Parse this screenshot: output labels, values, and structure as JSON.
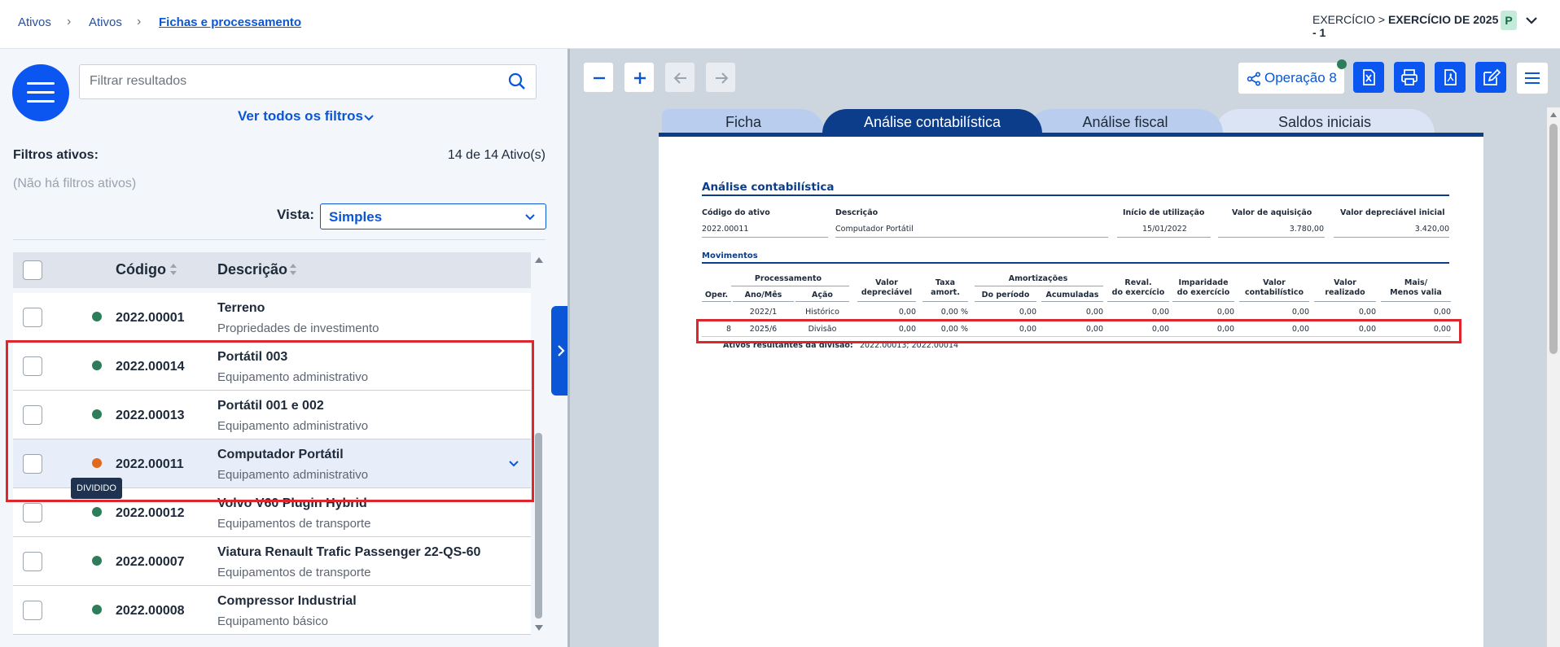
{
  "breadcrumb": {
    "items": [
      "Ativos",
      "Ativos"
    ],
    "current": "Fichas e processamento"
  },
  "exercise": {
    "prefix": "EXERCÍCIO > ",
    "value": "EXERCÍCIO DE 2025 - 1",
    "badge": "P"
  },
  "left": {
    "search_placeholder": "Filtrar resultados",
    "all_filters_label": "Ver todos os filtros",
    "active_filters_label": "Filtros ativos:",
    "count": "14 de 14 Ativo(s)",
    "no_filters": "(Não há filtros ativos)",
    "vista_label": "Vista:",
    "vista_value": "Simples",
    "columns": {
      "code": "Código",
      "description": "Descrição"
    },
    "rows": [
      {
        "code": "2022.00001",
        "name": "Terreno",
        "category": "Propriedades de investimento",
        "status": "active"
      },
      {
        "code": "2022.00014",
        "name": "Portátil 003",
        "category": "Equipamento administrativo",
        "status": "active"
      },
      {
        "code": "2022.00013",
        "name": "Portátil 001 e 002",
        "category": "Equipamento administrativo",
        "status": "active"
      },
      {
        "code": "2022.00011",
        "name": "Computador Portátil",
        "category": "Equipamento administrativo",
        "status": "divided"
      },
      {
        "code": "2022.00012",
        "name": "Volvo V60 Plugin Hybrid",
        "category": "Equipamentos de transporte",
        "status": "active"
      },
      {
        "code": "2022.00007",
        "name": "Viatura Renault Trafic Passenger 22-QS-60",
        "category": "Equipamentos de transporte",
        "status": "active"
      },
      {
        "code": "2022.00008",
        "name": "Compressor Industrial",
        "category": "Equipamento básico",
        "status": "active"
      }
    ],
    "tooltip": "DIVIDIDO"
  },
  "toolbar": {
    "operation_label": "Operação 8"
  },
  "tabs": [
    "Ficha",
    "Análise contabilística",
    "Análise fiscal",
    "Saldos iniciais"
  ],
  "report": {
    "title": "Análise contabilística",
    "header_labels": [
      "Código do ativo",
      "Descrição",
      "Início de utilização",
      "Valor de aquisição",
      "Valor depreciável inicial"
    ],
    "header_values": [
      "2022.00011",
      "Computador Portátil",
      "15/01/2022",
      "3.780,00",
      "3.420,00"
    ],
    "movements_label": "Movimentos",
    "group_processamento": "Processamento",
    "group_amortizacoes": "Amortizações",
    "col_oper": "Oper.",
    "col_anomes": "Ano/Mês",
    "col_acao": "Ação",
    "col_valor_dep_1": "Valor",
    "col_valor_dep_2": "depreciável",
    "col_taxa_1": "Taxa",
    "col_taxa_2": "amort.",
    "col_periodo": "Do período",
    "col_acumuladas": "Acumuladas",
    "col_reval_1": "Reval.",
    "col_reval_2": "do exercício",
    "col_imp_1": "Imparidade",
    "col_imp_2": "do exercício",
    "col_vcont_1": "Valor",
    "col_vcont_2": "contabilístico",
    "col_vreal_1": "Valor",
    "col_vreal_2": "realizado",
    "col_mais_1": "Mais/",
    "col_mais_2": "Menos valia",
    "rows": [
      [
        "",
        "2022/1",
        "Histórico",
        "0,00",
        "0,00 %",
        "0,00",
        "0,00",
        "0,00",
        "0,00",
        "0,00",
        "0,00",
        "0,00"
      ],
      [
        "8",
        "2025/6",
        "Divisão",
        "0,00",
        "0,00 %",
        "0,00",
        "0,00",
        "0,00",
        "0,00",
        "0,00",
        "0,00",
        "0,00"
      ]
    ],
    "division_label": "Ativos resultantes da divisão:",
    "division_value": "2022.00013; 2022.00014"
  }
}
